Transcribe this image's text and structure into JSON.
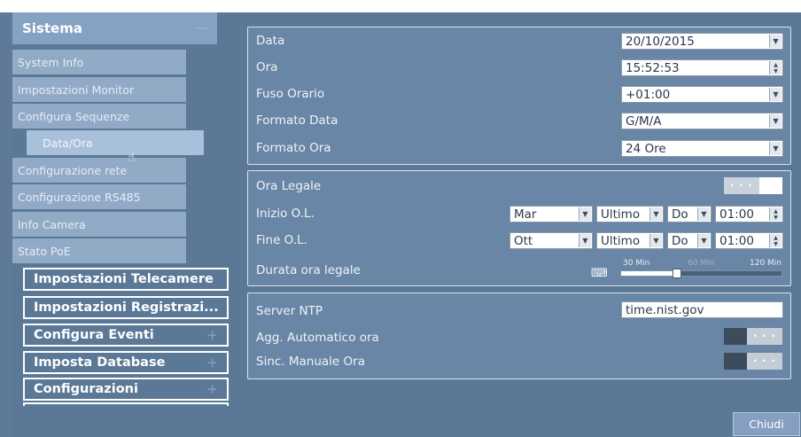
{
  "sidebar": {
    "section_title": "Sistema",
    "section_collapse_icon": "minus-icon",
    "items": [
      {
        "label": "System Info"
      },
      {
        "label": "Impostazioni Monitor"
      },
      {
        "label": "Configura Sequenze"
      },
      {
        "label": "Data/Ora"
      },
      {
        "label": "Configurazione rete"
      },
      {
        "label": "Configurazione RS485"
      },
      {
        "label": "Info Camera"
      },
      {
        "label": "Stato PoE"
      }
    ],
    "categories": [
      {
        "label": "Impostazioni Telecamere"
      },
      {
        "label": "Impostazioni Registrazi..."
      },
      {
        "label": "Configura Eventi"
      },
      {
        "label": "Imposta Database"
      },
      {
        "label": "Configurazioni"
      }
    ]
  },
  "datetime": {
    "date_label": "Data",
    "date_value": "20/10/2015",
    "time_label": "Ora",
    "time_value": "15:52:53",
    "tz_label": "Fuso Orario",
    "tz_value": "+01:00",
    "date_format_label": "Formato Data",
    "date_format_value": "G/M/A",
    "time_format_label": "Formato Ora",
    "time_format_value": "24 Ore"
  },
  "dst": {
    "label": "Ora Legale",
    "toggle_text": "• • •",
    "start_label": "Inizio O.L.",
    "start_month": "Mar",
    "start_week": "Ultimo",
    "start_day": "Do",
    "start_time": "01:00",
    "end_label": "Fine O.L.",
    "end_month": "Ott",
    "end_week": "Ultimo",
    "end_day": "Do",
    "end_time": "01:00",
    "duration_label": "Durata ora legale",
    "ticks": [
      "30 Min",
      "60 Min",
      "120 Min"
    ],
    "duration_fraction": 0.35
  },
  "ntp": {
    "server_label": "Server NTP",
    "server_value": "time.nist.gov",
    "auto_label": "Agg. Automatico ora",
    "auto_toggle_text": "• • •",
    "manual_label": "Sinc. Manuale Ora",
    "manual_toggle_text": "• • •"
  },
  "footer": {
    "close_label": "Chiudi"
  },
  "colors": {
    "background": "#5f7a99",
    "panel": "#6a86a6",
    "active_item": "#a8c0d9"
  }
}
